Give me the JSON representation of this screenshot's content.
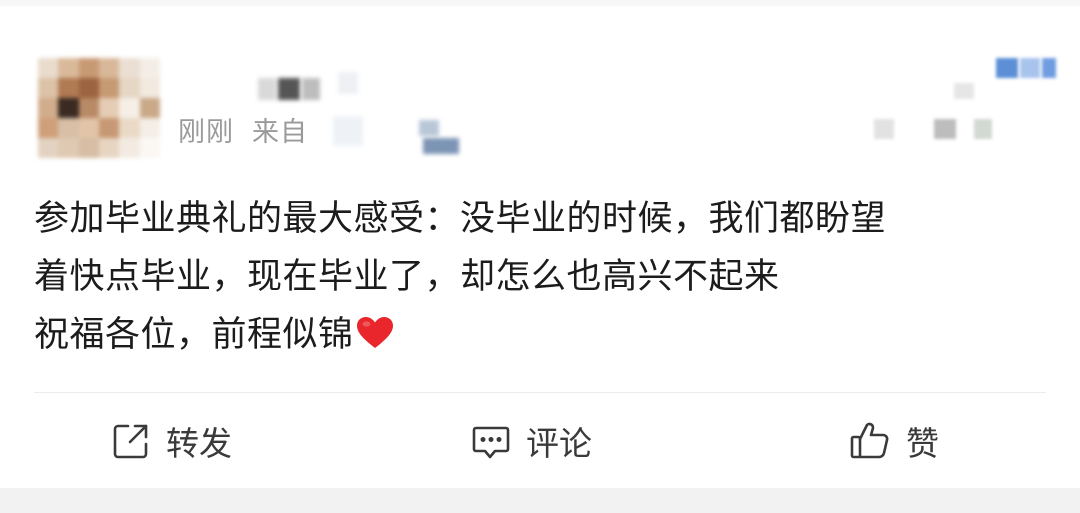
{
  "post": {
    "time_label": "刚刚",
    "source_prefix": "来自",
    "content_lines": [
      "参加毕业典礼的最大感受：没毕业的时候，我们都盼望",
      "着快点毕业，现在毕业了，却怎么也高兴不起来",
      "祝福各位，前程似锦"
    ],
    "emoji": "heart-emoji"
  },
  "actions": {
    "repost_label": "转发",
    "comment_label": "评论",
    "like_label": "赞"
  },
  "colors": {
    "text": "#1c1c1c",
    "meta": "#9a9a9a",
    "heart": "#e8262b"
  }
}
